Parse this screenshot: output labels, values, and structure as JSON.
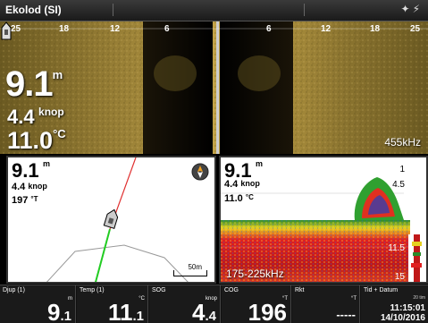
{
  "titlebar": {
    "title": "Ekolod (SI)",
    "icons": [
      "satellite-icon",
      "signal-icon"
    ]
  },
  "sidescan": {
    "range_labels": [
      "25",
      "18",
      "12",
      "6",
      "6",
      "12",
      "18",
      "25"
    ],
    "depth": {
      "value": "9.1",
      "unit": "m"
    },
    "speed": {
      "value": "4.4",
      "unit": "knop"
    },
    "temp": {
      "value": "11.0",
      "unit": "°C"
    },
    "frequency": "455kHz"
  },
  "chart": {
    "depth": {
      "value": "9.1",
      "unit": "m"
    },
    "speed": {
      "value": "4.4",
      "unit": "knop"
    },
    "heading": {
      "value": "197",
      "unit": "°T"
    },
    "scale_label": "50m"
  },
  "sonar": {
    "depth": {
      "value": "9.1",
      "unit": "m"
    },
    "speed": {
      "value": "4.4",
      "unit": "knop"
    },
    "temp": {
      "value": "11.0",
      "unit": "°C"
    },
    "scale": [
      "1",
      "4.5",
      "11.5",
      "15"
    ],
    "frequency": "175-225kHz"
  },
  "databar": {
    "cells": [
      {
        "label": "Djup (1)",
        "unit": "m",
        "int": "9",
        "dec": ".1"
      },
      {
        "label": "Temp (1)",
        "unit": "°C",
        "int": "11",
        "dec": ".1"
      },
      {
        "label": "SOG",
        "unit": "knop",
        "int": "4",
        "dec": ".4"
      },
      {
        "label": "COG",
        "unit": "°T",
        "int": "196",
        "dec": ""
      },
      {
        "label": "Rkt",
        "unit": "°T",
        "value": "-----"
      },
      {
        "label": "Tid + Datum",
        "tz": "20 tim",
        "time": "11:15:01",
        "date": "14/10/2016"
      }
    ]
  },
  "colors": {
    "sidescan_gold": "#caa94a",
    "heading_line": "#e03030",
    "track_line": "#22cc22"
  }
}
